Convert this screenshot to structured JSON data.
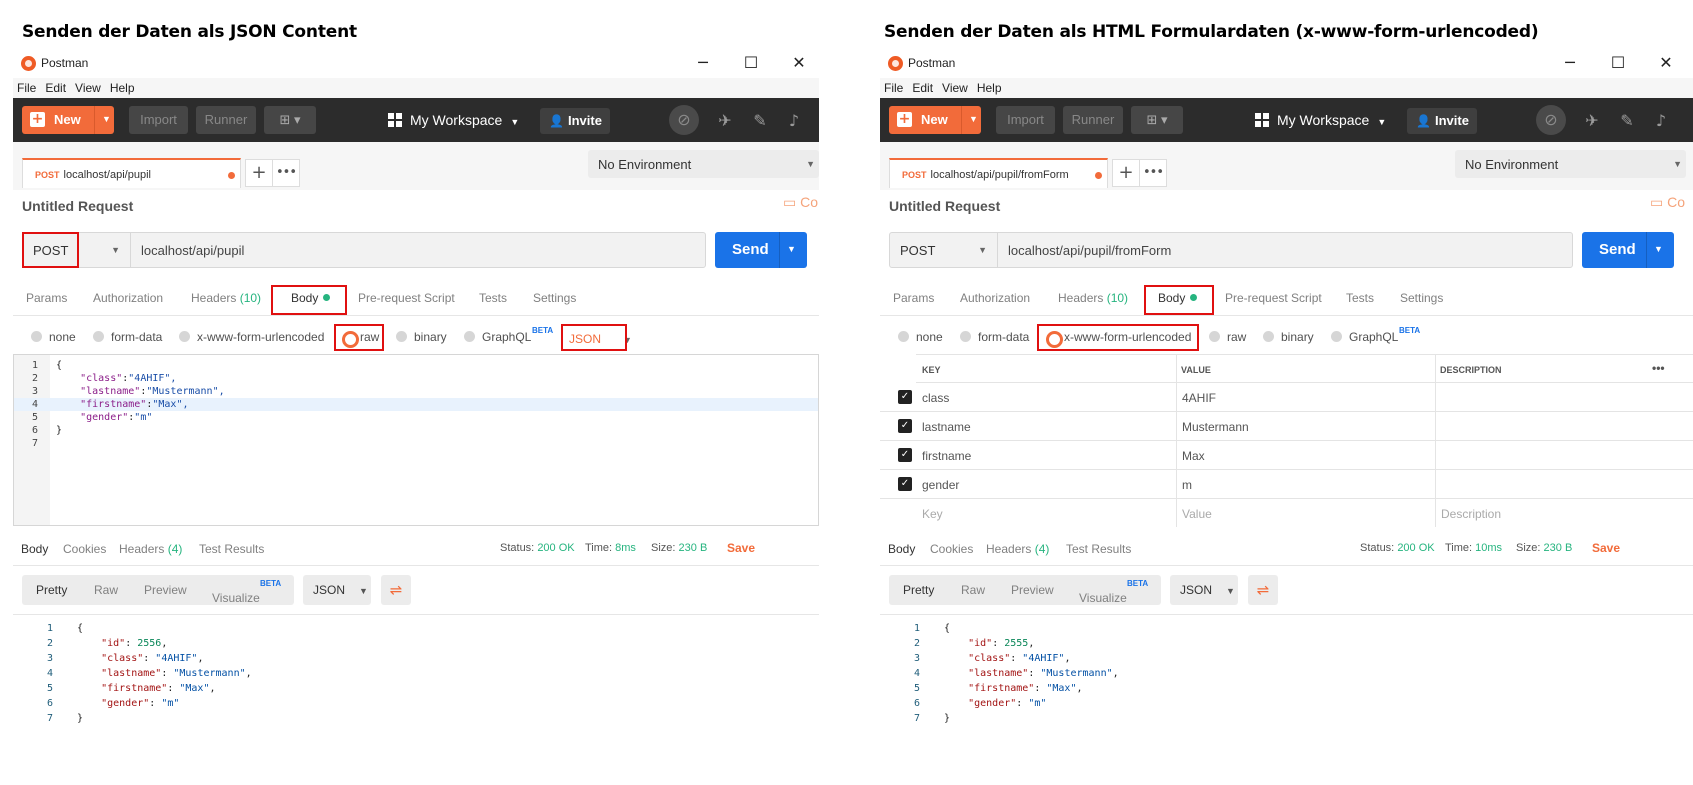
{
  "captions": {
    "left": "Senden der Daten als JSON Content",
    "right": "Senden der Daten als HTML Formulardaten (x-www-form-urlencoded)"
  },
  "window": {
    "title": "Postman",
    "minimize": "─",
    "maximize": "☐",
    "close": "✕"
  },
  "menu": [
    "File",
    "Edit",
    "View",
    "Help"
  ],
  "header": {
    "new": "New",
    "import": "Import",
    "runner": "Runner",
    "workspace": "My Workspace",
    "invite": "Invite"
  },
  "common": {
    "no_environment": "No Environment",
    "untitled_request": "Untitled Request",
    "method": "POST",
    "send": "Send",
    "tabs": {
      "params": "Params",
      "authorization": "Authorization",
      "headers": "Headers",
      "headers_count": "(10)",
      "body": "Body",
      "prerequest": "Pre-request Script",
      "tests": "Tests",
      "settings": "Settings"
    },
    "body_types": {
      "none": "none",
      "form_data": "form-data",
      "urlencoded": "x-www-form-urlencoded",
      "raw": "raw",
      "binary": "binary",
      "graphql": "GraphQL",
      "beta": "BETA"
    },
    "response_tabs": {
      "body": "Body",
      "cookies": "Cookies",
      "headers": "Headers",
      "headers_count": "(4)",
      "test_results": "Test Results"
    },
    "status_label": "Status:",
    "status_value": "200 OK",
    "time_label": "Time:",
    "size_label": "Size:",
    "size_value": "230 B",
    "save": "Save",
    "resp_views": {
      "pretty": "Pretty",
      "raw": "Raw",
      "preview": "Preview",
      "visualize": "Visualize",
      "beta": "BETA",
      "format": "JSON"
    }
  },
  "left": {
    "tab_url": "localhost/api/pupil",
    "url": "localhost/api/pupil",
    "content_type": "JSON",
    "time_value": "8ms",
    "request_body": [
      {
        "n": "1",
        "t": "{"
      },
      {
        "n": "2",
        "k": "\"class\"",
        "v": "\"4AHIF\","
      },
      {
        "n": "3",
        "k": "\"lastname\"",
        "v": "\"Mustermann\","
      },
      {
        "n": "4",
        "k": "\"firstname\"",
        "v": "\"Max\","
      },
      {
        "n": "5",
        "k": "\"gender\"",
        "v": "\"m\""
      },
      {
        "n": "6",
        "t": "}"
      },
      {
        "n": "7",
        "t": ""
      }
    ],
    "response": {
      "id": "2556",
      "lines": [
        "1",
        "2",
        "3",
        "4",
        "5",
        "6",
        "7"
      ]
    }
  },
  "right": {
    "tab_url": "localhost/api/pupil/fromForm",
    "url": "localhost/api/pupil/fromForm",
    "time_value": "10ms",
    "table": {
      "col_key": "KEY",
      "col_value": "VALUE",
      "col_description": "DESCRIPTION",
      "rows": [
        {
          "key": "class",
          "value": "4AHIF"
        },
        {
          "key": "lastname",
          "value": "Mustermann"
        },
        {
          "key": "firstname",
          "value": "Max"
        },
        {
          "key": "gender",
          "value": "m"
        }
      ],
      "placeholder_key": "Key",
      "placeholder_value": "Value",
      "placeholder_description": "Description"
    },
    "response": {
      "id": "2555"
    }
  },
  "response_fields": [
    {
      "k": "\"class\"",
      "v": "\"4AHIF\""
    },
    {
      "k": "\"lastname\"",
      "v": "\"Mustermann\""
    },
    {
      "k": "\"firstname\"",
      "v": "\"Max\""
    },
    {
      "k": "\"gender\"",
      "v": "\"m\""
    }
  ],
  "colors": {
    "accent": "#f26b3a",
    "send": "#1a73e8",
    "success": "#26b47f",
    "highlight": "#e01010"
  }
}
